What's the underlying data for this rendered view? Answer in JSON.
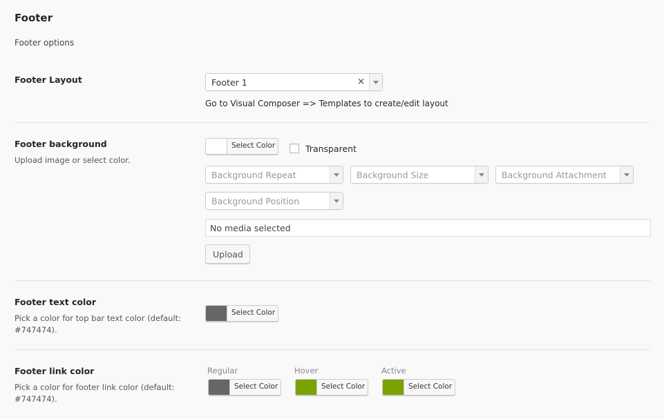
{
  "section": {
    "title": "Footer",
    "description": "Footer options"
  },
  "footer_layout": {
    "label": "Footer Layout",
    "selected": "Footer 1",
    "clear_glyph": "×",
    "help": "Go to Visual Composer => Templates to create/edit layout"
  },
  "footer_background": {
    "label": "Footer background",
    "description": "Upload image or select color.",
    "color_button_label": "Select Color",
    "color": "#ffffff",
    "transparent_label": "Transparent",
    "transparent_checked": false,
    "bg_repeat_placeholder": "Background Repeat",
    "bg_size_placeholder": "Background Size",
    "bg_attachment_placeholder": "Background Attachment",
    "bg_position_placeholder": "Background Position",
    "media_value": "No media selected",
    "upload_label": "Upload"
  },
  "footer_text_color": {
    "label": "Footer text color",
    "description": "Pick a color for top bar text color (default: #747474).",
    "color_button_label": "Select Color",
    "color": "#666666"
  },
  "footer_link_color": {
    "label": "Footer link color",
    "description": "Pick a color for footer link color (default: #747474).",
    "regular_label": "Regular",
    "hover_label": "Hover",
    "active_label": "Active",
    "regular_button_label": "Select Color",
    "hover_button_label": "Select Color",
    "active_button_label": "Select Color",
    "regular_color": "#666666",
    "hover_color": "#7aa200",
    "active_color": "#7aa200"
  }
}
